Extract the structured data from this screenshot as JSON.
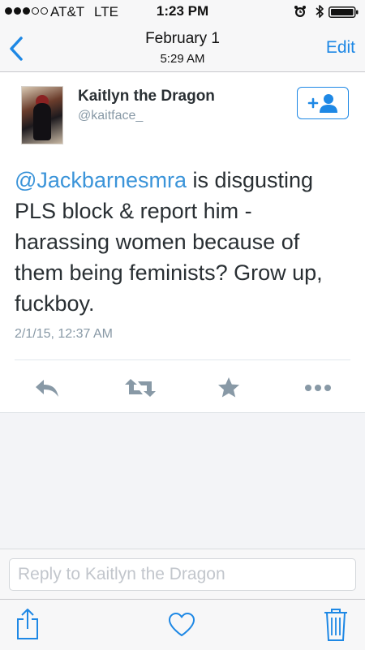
{
  "status_bar": {
    "carrier": "AT&T",
    "network": "LTE",
    "time": "1:23 PM"
  },
  "nav": {
    "title": "February 1",
    "subtitle": "5:29 AM",
    "edit_label": "Edit"
  },
  "tweet": {
    "author_name": "Kaitlyn the Dragon",
    "author_handle": "@kaitface_",
    "mention": "@Jackbarnesmra",
    "text": " is disgusting PLS block & report him - harassing women because of them being feminists? Grow up, fuckboy.",
    "timestamp": "2/1/15, 12:37 AM"
  },
  "reply": {
    "placeholder": "Reply to Kaitlyn the Dragon"
  },
  "icons": {
    "back": "chevron-left-icon",
    "follow": "add-user-icon",
    "reply": "reply-arrow-icon",
    "retweet": "retweet-icon",
    "favorite": "star-icon",
    "more": "more-dots-icon",
    "share": "share-icon",
    "like": "heart-icon",
    "delete": "trash-icon"
  },
  "colors": {
    "accent": "#1e88e5",
    "mention": "#3b94d9",
    "muted": "#8899a6",
    "action_icon": "#8899a6"
  }
}
